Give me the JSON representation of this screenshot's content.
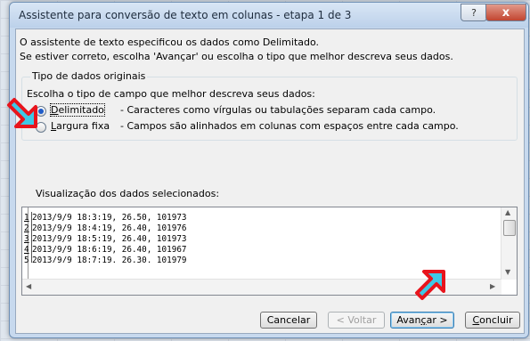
{
  "window": {
    "title": "Assistente para conversão de texto em colunas - etapa 1 de 3",
    "help_glyph": "?",
    "close_glyph": "x"
  },
  "intro": {
    "line1": "O assistente de texto especificou os dados como Delimitado.",
    "line2": "Se estiver correto, escolha 'Avançar' ou escolha o tipo que melhor descreva seus dados."
  },
  "original_type": {
    "group_label": "Tipo de dados originais",
    "prompt": "Escolha o tipo de campo que melhor descreva seus dados:",
    "options": [
      {
        "label_accel": "D",
        "label_rest": "elimitado",
        "description": "- Caracteres como vírgulas ou tabulações separam cada campo.",
        "selected": true
      },
      {
        "label_accel": "L",
        "label_rest": "argura fixa",
        "description": "- Campos são alinhados em colunas com espaços entre cada campo.",
        "selected": false
      }
    ]
  },
  "preview": {
    "label": "Visualização dos dados selecionados:",
    "rows": [
      {
        "num": "1",
        "text": "2013/9/9 18:3:19, 26.50, 101973"
      },
      {
        "num": "2",
        "text": "2013/9/9 18:4:19, 26.40, 101976"
      },
      {
        "num": "3",
        "text": "2013/9/9 18:5:19, 26.40, 101973"
      },
      {
        "num": "4",
        "text": "2013/9/9 18:6:19, 26.40, 101967"
      },
      {
        "num": "5",
        "text": "2013/9/9 18:7:19, 26.30, 101979"
      }
    ]
  },
  "buttons": {
    "cancel": "Cancelar",
    "back": "< Voltar",
    "next_pre": "Avan",
    "next_accel": "ç",
    "next_post": "ar >",
    "finish_accel": "C",
    "finish_rest": "oncluir"
  },
  "colors": {
    "callout_fill": "#3fc8e6",
    "callout_border": "#e8141c"
  }
}
